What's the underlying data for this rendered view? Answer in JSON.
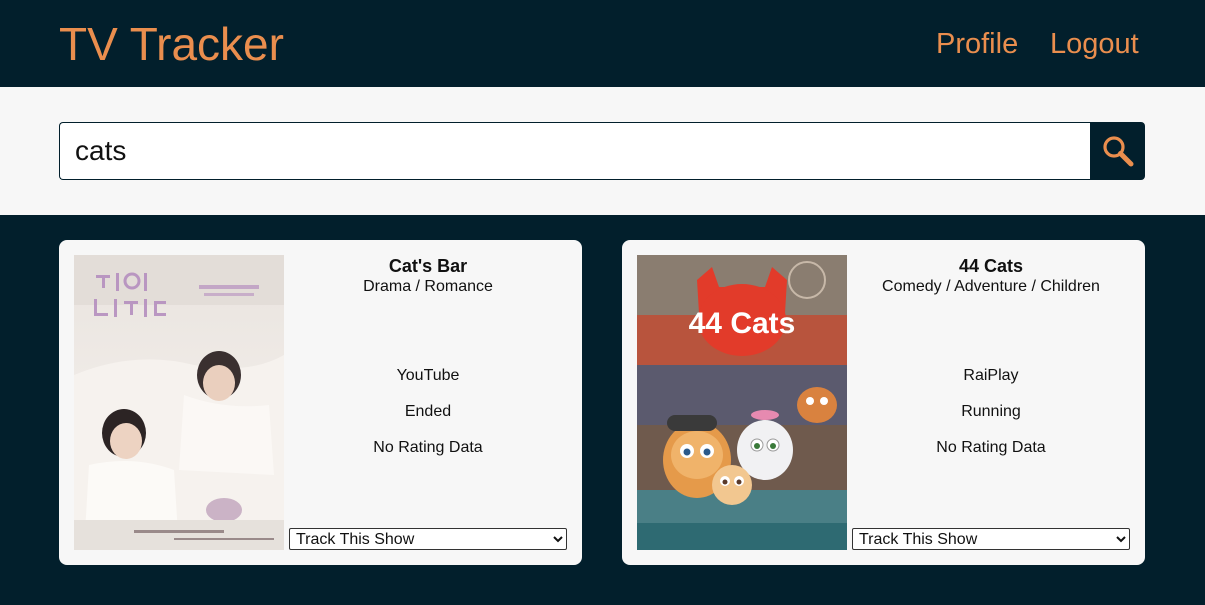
{
  "header": {
    "brand": "TV Tracker",
    "nav": {
      "profile": "Profile",
      "logout": "Logout"
    }
  },
  "search": {
    "value": "cats",
    "button_icon": "search-icon"
  },
  "colors": {
    "navy": "#021f2c",
    "accent": "#ea8e4e",
    "panel": "#f7f7f7"
  },
  "results": [
    {
      "title": "Cat's Bar",
      "genres": "Drama / Romance",
      "network": "YouTube",
      "status": "Ended",
      "rating": "No Rating Data",
      "track_option": "Track This Show",
      "poster_icon": "show-poster-image"
    },
    {
      "title": "44 Cats",
      "genres": "Comedy / Adventure / Children",
      "network": "RaiPlay",
      "status": "Running",
      "rating": "No Rating Data",
      "track_option": "Track This Show",
      "poster_icon": "show-poster-image",
      "poster_logo_text": "44 Cats"
    }
  ]
}
